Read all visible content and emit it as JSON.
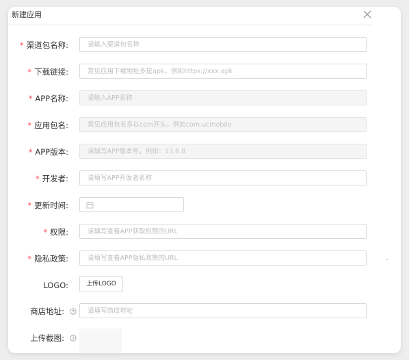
{
  "modal": {
    "title": "新建应用"
  },
  "form": {
    "channel_name": {
      "label": "渠道包名称:",
      "placeholder": "请输入渠道包名称",
      "required": true
    },
    "download_link": {
      "label": "下载链接:",
      "placeholder": "常见应用下载地址多是apk，例如https://xxx.apk",
      "required": true
    },
    "app_name": {
      "label": "APP名称:",
      "placeholder": "请输入APP名称",
      "required": true
    },
    "package_name": {
      "label": "应用包名:",
      "placeholder": "常见应用包名多以com开头，例如com.ucmobile",
      "required": true
    },
    "app_version": {
      "label": "APP版本:",
      "placeholder": "请填写APP版本号，例如：13.6.8",
      "required": true
    },
    "developer": {
      "label": "开发者:",
      "placeholder": "请填写APP开发者名称",
      "required": true
    },
    "update_time": {
      "label": "更新时间:",
      "required": true
    },
    "permissions": {
      "label": "权限:",
      "placeholder": "请填写查看APP获取权限的URL",
      "required": true
    },
    "privacy_policy": {
      "label": "隐私政策:",
      "placeholder": "请填写查看APP隐私政策的URL",
      "required": true
    },
    "logo": {
      "label": "LOGO:",
      "button_label": "上传LOGO"
    },
    "store_address": {
      "label": "商店地址:",
      "placeholder": "请填写商店地址"
    },
    "screenshots": {
      "label": "上传截图:"
    }
  },
  "icons": {
    "close": "close-icon",
    "calendar": "calendar-icon",
    "help": "question-circle-icon"
  },
  "colors": {
    "required_mark": "#ff4d4f",
    "label_text": "#333333",
    "placeholder": "#bfbfbf",
    "border": "#d9d9d9",
    "disabled_bg": "#f5f5f5"
  }
}
